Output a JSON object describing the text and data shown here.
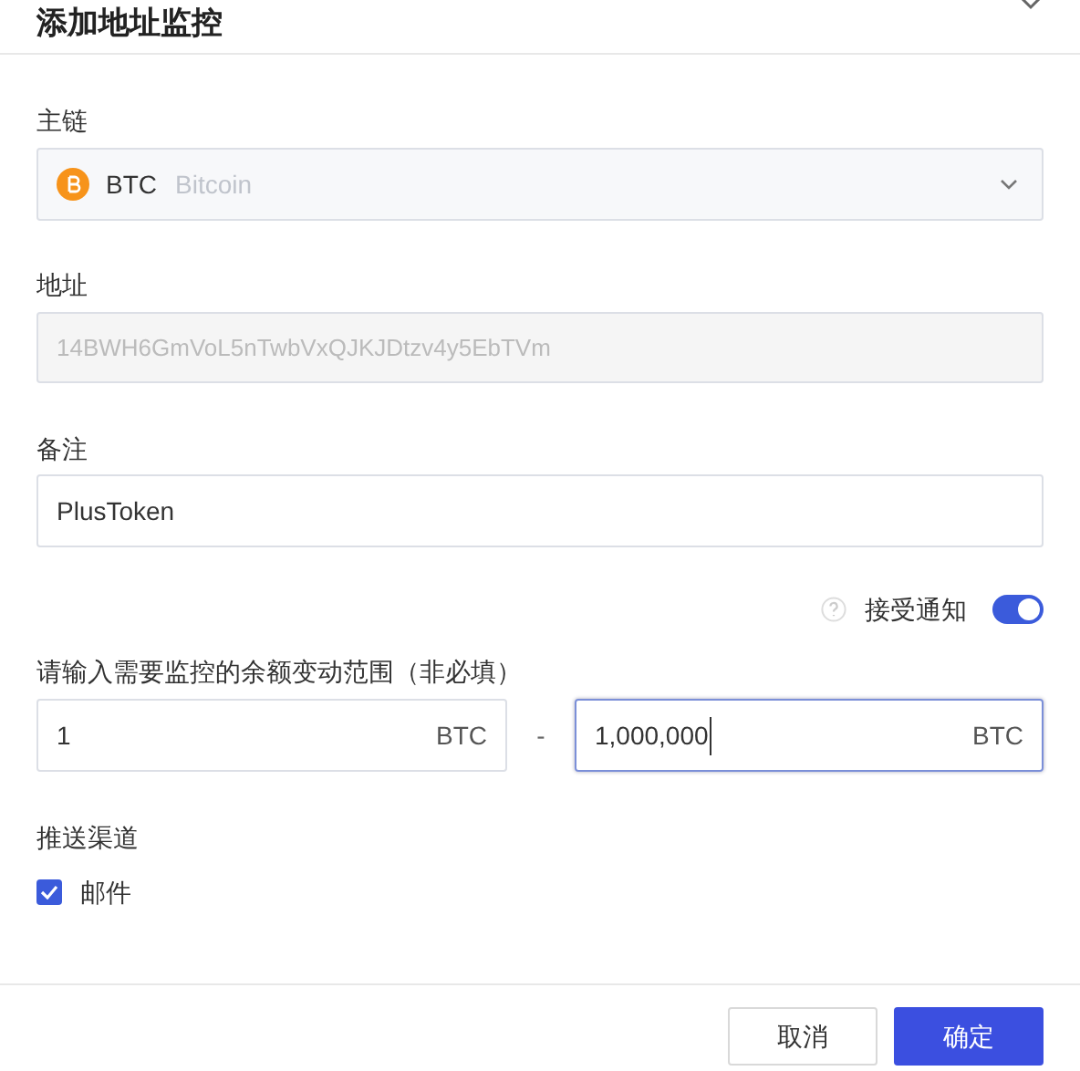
{
  "dialog": {
    "title": "添加地址监控"
  },
  "chain": {
    "label": "主链",
    "symbol": "BTC",
    "name": "Bitcoin"
  },
  "address": {
    "label": "地址",
    "value": "14BWH6GmVoL5nTwbVxQJKJDtzv4y5EbTVm",
    "disabled": true
  },
  "note": {
    "label": "备注",
    "value": "PlusToken"
  },
  "notify": {
    "label": "接受通知",
    "on": true
  },
  "range": {
    "label": "请输入需要监控的余额变动范围（非必填）",
    "min": "1",
    "min_unit": "BTC",
    "separator": "-",
    "max": "1,000,000",
    "max_unit": "BTC"
  },
  "channels": {
    "label": "推送渠道",
    "items": [
      {
        "label": "邮件",
        "checked": true
      }
    ]
  },
  "buttons": [
    {
      "label": "取消",
      "kind": "secondary"
    },
    {
      "label": "确定",
      "kind": "primary"
    }
  ]
}
